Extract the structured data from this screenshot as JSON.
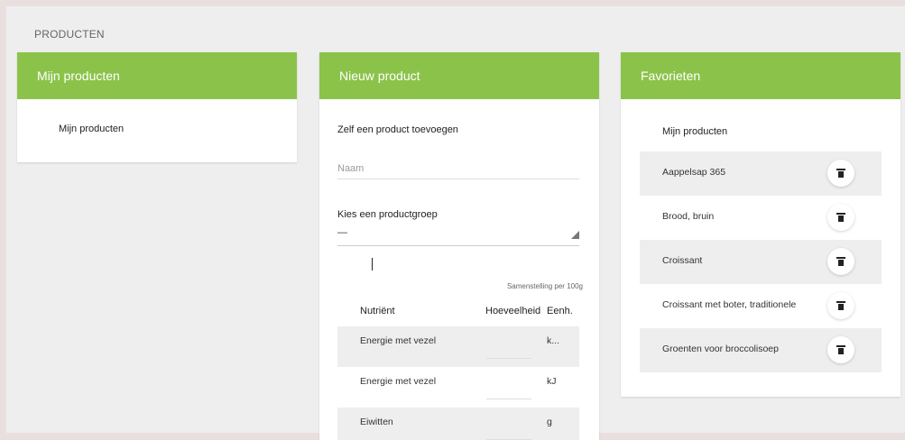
{
  "page": {
    "title": "PRODUCTEN"
  },
  "my_products": {
    "header": "Mijn producten",
    "sub": "Mijn producten"
  },
  "new_product": {
    "header": "Nieuw product",
    "add_label": "Zelf een product toevoegen",
    "name_placeholder": "Naam",
    "group_label": "Kies een productgroep",
    "group_value": "—",
    "per100": "Samenstelling per 100g",
    "columns": {
      "nutrient": "Nutriënt",
      "amount": "Hoeveelheid",
      "unit": "Eenh."
    },
    "rows": [
      {
        "name": "Energie met vezel",
        "unit": "k..."
      },
      {
        "name": "Energie met vezel",
        "unit": "kJ"
      },
      {
        "name": "Eiwitten",
        "unit": "g"
      }
    ]
  },
  "favorites": {
    "header": "Favorieten",
    "sub": "Mijn producten",
    "items": [
      {
        "name": "Aappelsap 365"
      },
      {
        "name": "Brood, bruin"
      },
      {
        "name": "Croissant"
      },
      {
        "name": "Croissant met boter, traditionele"
      },
      {
        "name": "Groenten voor broccolisoep"
      }
    ],
    "delete_icon": "trash-icon"
  },
  "colors": {
    "accent": "#8bc34a",
    "background": "#eeeeee",
    "outer": "#eadfdf"
  }
}
